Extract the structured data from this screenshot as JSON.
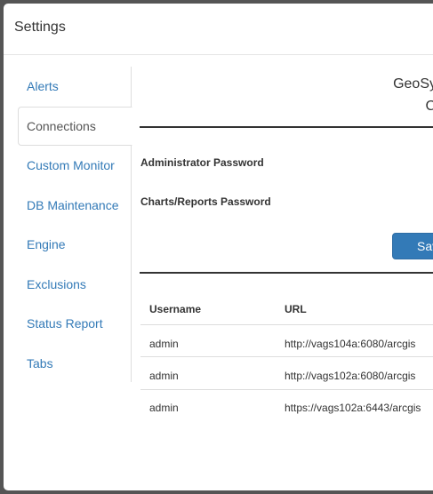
{
  "modal": {
    "title": "Settings"
  },
  "nav": {
    "items": [
      {
        "label": "Alerts"
      },
      {
        "label": "Connections"
      },
      {
        "label": "Custom Monitor"
      },
      {
        "label": "DB Maintenance"
      },
      {
        "label": "Engine"
      },
      {
        "label": "Exclusions"
      },
      {
        "label": "Status Report"
      },
      {
        "label": "Tabs"
      }
    ],
    "active": "Connections"
  },
  "content": {
    "heading_line1": "GeoSys",
    "heading_line2": "Co",
    "admin_password_label": "Administrator Password",
    "reports_password_label": "Charts/Reports Password",
    "save_label": "Save",
    "table": {
      "headers": [
        "Username",
        "URL"
      ],
      "rows": [
        [
          "admin",
          "http://vags104a:6080/arcgis"
        ],
        [
          "admin",
          "http://vags102a:6080/arcgis"
        ],
        [
          "admin",
          "https://vags102a:6443/arcgis"
        ]
      ]
    }
  },
  "colors": {
    "accent": "#337ab7",
    "backdrop": "#555555"
  }
}
